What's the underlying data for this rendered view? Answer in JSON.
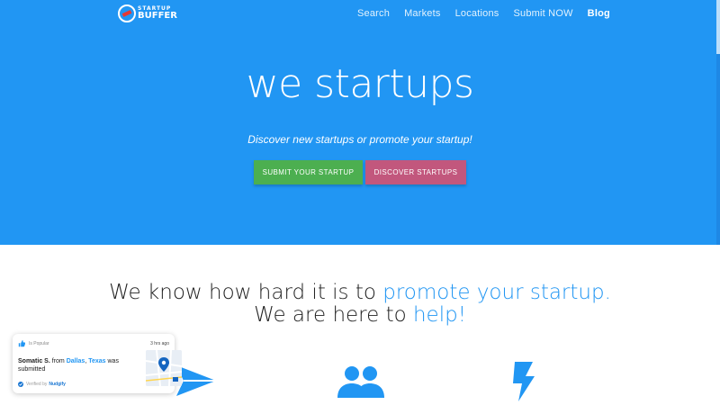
{
  "header": {
    "logo_top": "STARTUP",
    "logo_bottom": "BUFFER",
    "nav": [
      "Search",
      "Markets",
      "Locations",
      "Submit NOW",
      "Blog"
    ]
  },
  "hero": {
    "title": "we startups",
    "subtitle": "Discover new startups or promote your startup!",
    "submit_button": "SUBMIT YOUR STARTUP",
    "discover_button": "DISCOVER STARTUPS"
  },
  "section": {
    "tagline_part1": "We know how hard it is to ",
    "tagline_hl1": "promote your startup.",
    "tagline_part2": " We are here to ",
    "tagline_hl2": "help!"
  },
  "notification": {
    "label": "Is Popular",
    "time": "3 hrs ago",
    "name": "Somatic S.",
    "from": " from ",
    "city": "Dallas",
    "comma": ", ",
    "state": "Texas",
    "action": " was submitted",
    "verified_label": "Verified by",
    "verified_brand": "Nudgify"
  },
  "colors": {
    "hero_bg": "#2196f3",
    "submit_green": "#4caf50",
    "discover_pink": "#c2577d",
    "accent_blue": "#2196f3"
  },
  "icons": [
    "paper-plane-icon",
    "people-icon",
    "lightning-bolt-icon",
    "thumbs-up-icon",
    "verified-check-icon",
    "map-pin-icon"
  ]
}
